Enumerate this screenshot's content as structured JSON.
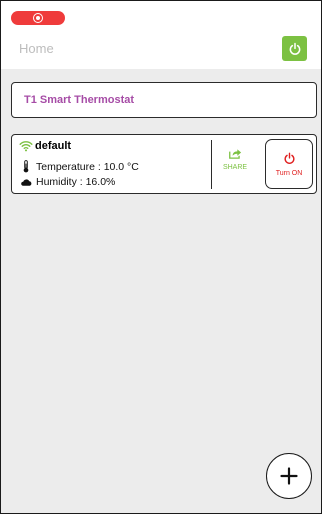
{
  "status": {
    "recording_icon": "record-icon",
    "recording_color": "#ef3b3b"
  },
  "header": {
    "title": "Home",
    "power_icon": "power-icon",
    "power_color": "#7cc142"
  },
  "group": {
    "title": "T1 Smart Thermostat",
    "title_color": "#a64ca6"
  },
  "device": {
    "name": "default",
    "wifi_icon": "wifi-icon",
    "temperature_label": "Temperature : 10.0 °C",
    "temperature_icon": "thermometer-icon",
    "humidity_label": "Humidity : 16.0%",
    "humidity_icon": "cloud-icon",
    "share_label": "SHARE",
    "share_icon": "share-icon",
    "share_color": "#7cc142",
    "turn_on_label": "Turn ON",
    "turn_on_icon": "power-icon",
    "turn_on_color": "#e02020"
  },
  "fab": {
    "icon": "plus-icon"
  }
}
